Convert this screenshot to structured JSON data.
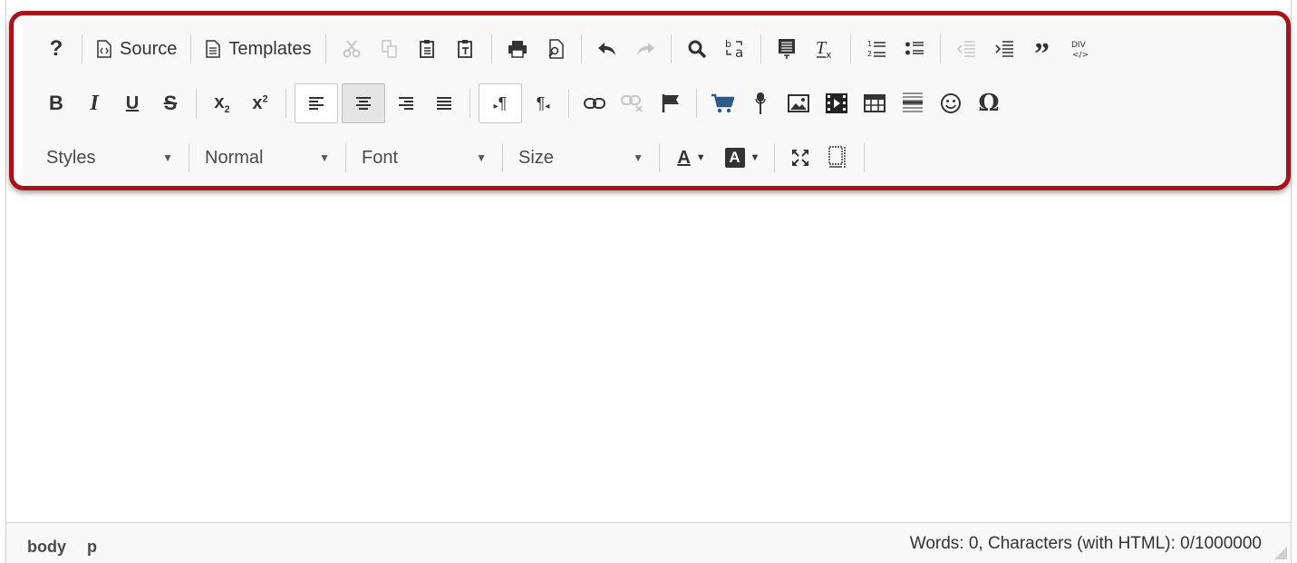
{
  "toolbar": {
    "source_label": "Source",
    "templates_label": "Templates",
    "styles_label": "Styles",
    "format_label": "Normal",
    "font_label": "Font",
    "size_label": "Size"
  },
  "status": {
    "path": [
      "body",
      "p"
    ],
    "counter": "Words: 0, Characters (with HTML): 0/1000000"
  },
  "colors": {
    "highlight_border": "#a8101a",
    "toolbar_bg": "#f8f8f8",
    "icon": "#333333",
    "icon_disabled": "#c6c6c6",
    "flag_icon": "#2b5a8a"
  },
  "icons": {
    "row1": [
      "help-icon",
      "source-icon",
      "templates-icon",
      "cut-icon",
      "copy-icon",
      "paste-icon",
      "paste-text-icon",
      "print-icon",
      "preview-icon",
      "undo-icon",
      "redo-icon",
      "find-icon",
      "replace-icon",
      "spellcheck-icon",
      "remove-format-icon",
      "numbered-list-icon",
      "bullet-list-icon",
      "outdent-icon",
      "indent-icon",
      "blockquote-icon",
      "div-icon"
    ],
    "row2": [
      "bold-icon",
      "italic-icon",
      "underline-icon",
      "strike-icon",
      "subscript-icon",
      "superscript-icon",
      "align-left-icon",
      "align-center-icon",
      "align-right-icon",
      "justify-icon",
      "ltr-icon",
      "rtl-icon",
      "link-icon",
      "unlink-icon",
      "anchor-icon",
      "cart-icon",
      "audio-icon",
      "image-icon",
      "video-icon",
      "table-icon",
      "horizontal-rule-icon",
      "smiley-icon",
      "special-char-icon"
    ],
    "row3": [
      "text-color-icon",
      "background-color-icon",
      "maximize-icon",
      "show-blocks-icon"
    ]
  }
}
